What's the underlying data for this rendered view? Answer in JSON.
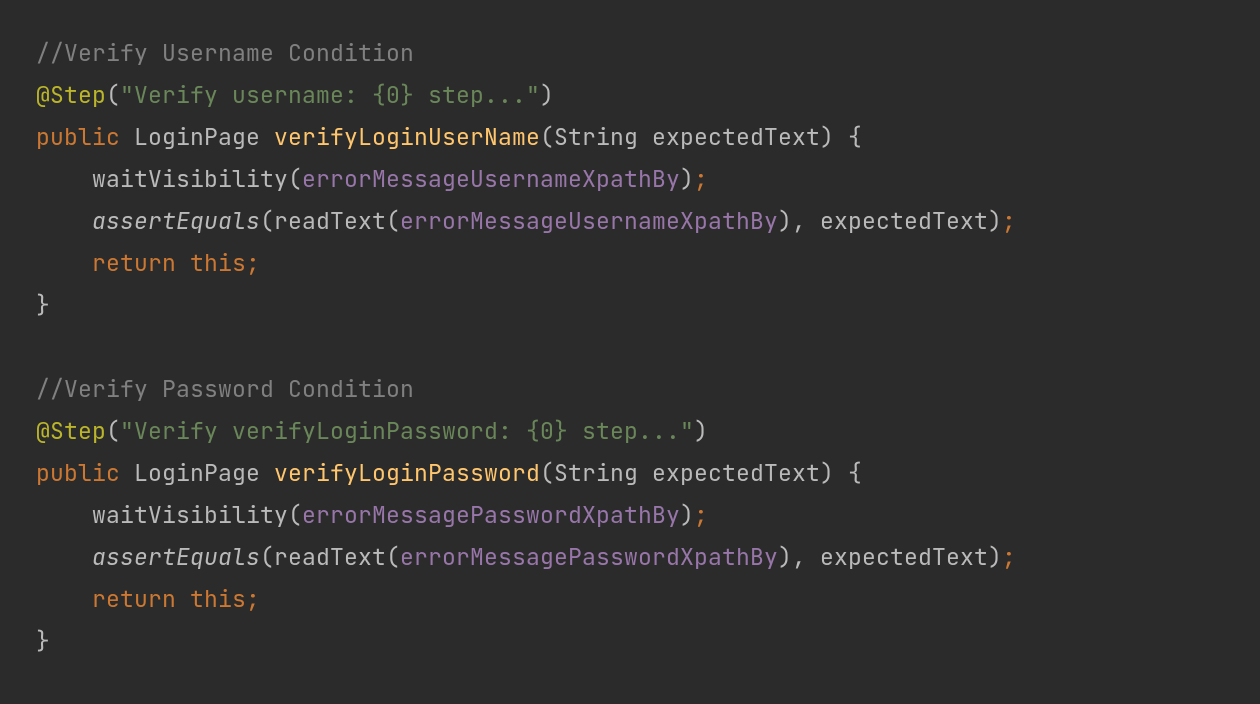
{
  "code": {
    "comment1": "//Verify Username Condition",
    "anno1_prefix": "@Step",
    "anno1_open": "(",
    "anno1_string": "\"Verify username: {0} step...\"",
    "anno1_close": ")",
    "kw_public1": "public",
    "type_loginpage1": "LoginPage",
    "method1": "verifyLoginUserName",
    "sig1_open": "(",
    "sig1_paramtype": "String",
    "sig1_paramname": "expectedText",
    "sig1_close": ")",
    "brace_open": "{",
    "indent_guide": "",
    "call_waitVis": "waitVisibility",
    "field_errUser": "errorMessageUsernameXpathBy",
    "call_assertEq": "assertEquals",
    "call_readText": "readText",
    "param_expected": "expectedText",
    "kw_return": "return",
    "kw_this": "this",
    "brace_close": "}",
    "semicolon": ";",
    "comma": ", ",
    "paren_open": "(",
    "paren_close": ")",
    "comment2": "//Verify Password Condition",
    "anno2_prefix": "@Step",
    "anno2_string": "\"Verify verifyLoginPassword: {0} step...\"",
    "method2": "verifyLoginPassword",
    "field_errPass": "errorMessagePasswordXpathBy"
  }
}
